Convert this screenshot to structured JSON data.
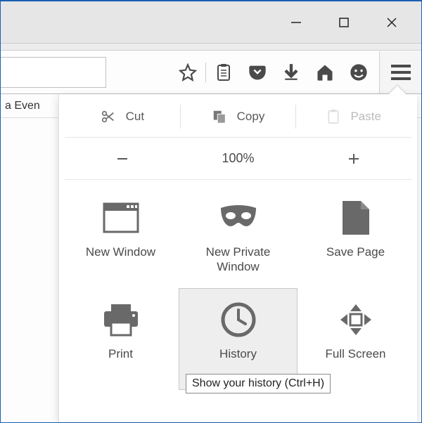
{
  "bookmark_bar_text": "a Even",
  "edit": {
    "cut": "Cut",
    "copy": "Copy",
    "paste": "Paste"
  },
  "zoom": {
    "level": "100%"
  },
  "grid": {
    "new_window": "New Window",
    "new_private": "New Private\nWindow",
    "save_page": "Save Page",
    "print": "Print",
    "history": "History",
    "full_screen": "Full Screen"
  },
  "tooltip": {
    "history": "Show your history (Ctrl+H)"
  }
}
